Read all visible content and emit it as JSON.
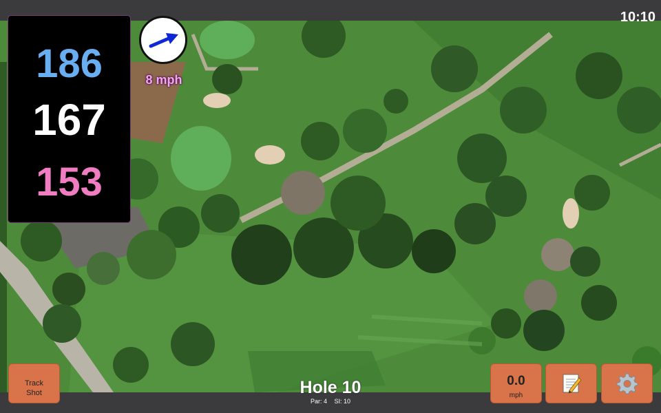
{
  "status_bar": {
    "time": "10:10"
  },
  "distances": {
    "back": "186",
    "center": "167",
    "front": "153"
  },
  "wind": {
    "speed_label": "8 mph",
    "icon": "arrow-icon",
    "direction": "east-northeast"
  },
  "hole": {
    "title": "Hole 10",
    "par": "Par: 4",
    "stroke_index": "SI: 10"
  },
  "buttons": {
    "track_shot": "Track Shot",
    "speed_value": "0.0",
    "speed_unit": "mph",
    "notes_icon": "notepad-icon",
    "settings_icon": "gear-icon"
  },
  "colors": {
    "back": "#69aef0",
    "center": "#ffffff",
    "front": "#f07cc2",
    "button": "#d9734a",
    "wind_label": "#f0a8f0",
    "bar": "#3b3b3d"
  },
  "map": {
    "type": "satellite-imagery"
  }
}
